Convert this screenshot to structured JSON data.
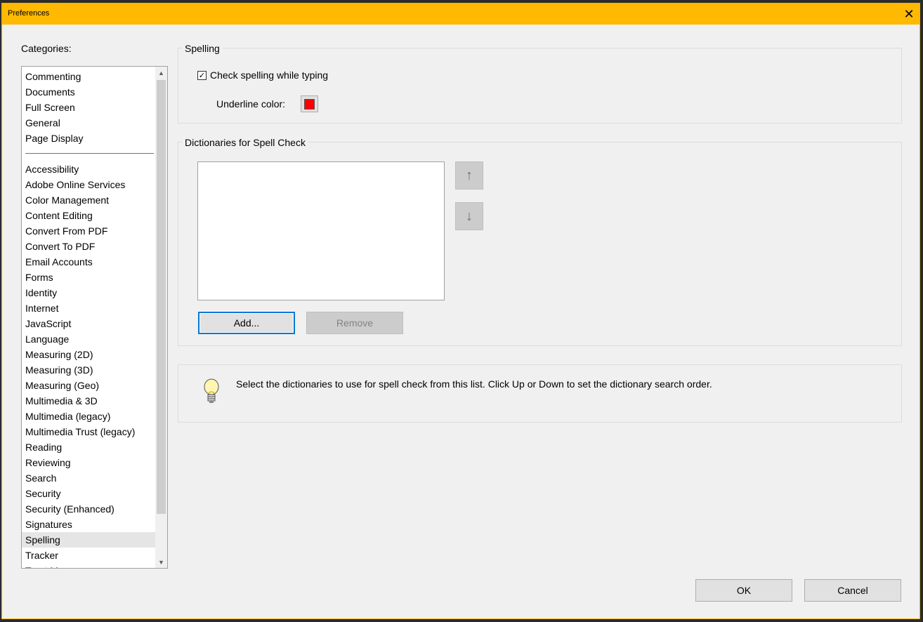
{
  "window": {
    "title": "Preferences",
    "close_glyph": "✕"
  },
  "categories": {
    "label": "Categories:",
    "top_items": [
      "Commenting",
      "Documents",
      "Full Screen",
      "General",
      "Page Display"
    ],
    "items": [
      "Accessibility",
      "Adobe Online Services",
      "Color Management",
      "Content Editing",
      "Convert From PDF",
      "Convert To PDF",
      "Email Accounts",
      "Forms",
      "Identity",
      "Internet",
      "JavaScript",
      "Language",
      "Measuring (2D)",
      "Measuring (3D)",
      "Measuring (Geo)",
      "Multimedia & 3D",
      "Multimedia (legacy)",
      "Multimedia Trust (legacy)",
      "Reading",
      "Reviewing",
      "Search",
      "Security",
      "Security (Enhanced)",
      "Signatures",
      "Spelling",
      "Tracker",
      "Trust Manager"
    ],
    "selected": "Spelling"
  },
  "spelling_group": {
    "title": "Spelling",
    "check_label": "Check spelling while typing",
    "checked": true,
    "underline_label": "Underline color:",
    "underline_color": "#ff0000"
  },
  "dictionaries_group": {
    "title": "Dictionaries for Spell Check",
    "up_glyph": "↑",
    "down_glyph": "↓",
    "add_label": "Add...",
    "remove_label": "Remove"
  },
  "tip": {
    "icon": "lightbulb-icon",
    "text": "Select the dictionaries to use for spell check from this list.  Click Up or Down to set the dictionary search order."
  },
  "footer": {
    "ok_label": "OK",
    "cancel_label": "Cancel"
  },
  "colors": {
    "title_bar": "#ffb900",
    "focus": "#0078d7"
  }
}
